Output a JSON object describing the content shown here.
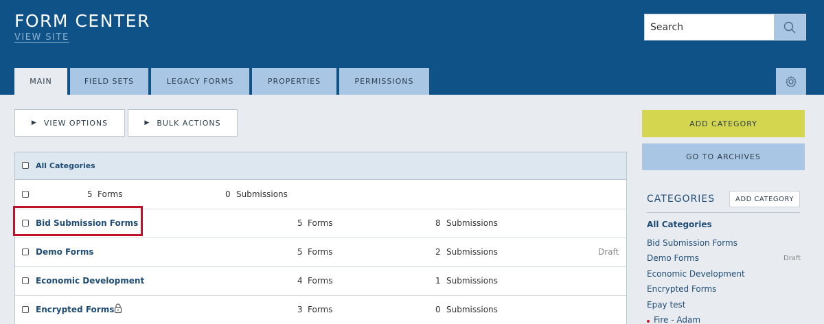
{
  "header": {
    "title": "FORM CENTER",
    "view_site": "VIEW SITE",
    "search_placeholder": "Search"
  },
  "tabs": [
    {
      "label": "MAIN",
      "active": true
    },
    {
      "label": "FIELD SETS"
    },
    {
      "label": "LEGACY FORMS"
    },
    {
      "label": "PROPERTIES"
    },
    {
      "label": "PERMISSIONS"
    }
  ],
  "toolbar": {
    "view_options": "VIEW OPTIONS",
    "bulk_actions": "BULK ACTIONS"
  },
  "table": {
    "header_label": "All Categories",
    "rows": [
      {
        "name": "",
        "forms": "5",
        "forms_label": "Forms",
        "submissions": "0",
        "submissions_label": "Submissions",
        "status": ""
      },
      {
        "name": "Bid Submission Forms",
        "forms": "5",
        "forms_label": "Forms",
        "submissions": "8",
        "submissions_label": "Submissions",
        "status": ""
      },
      {
        "name": "Demo Forms",
        "forms": "5",
        "forms_label": "Forms",
        "submissions": "2",
        "submissions_label": "Submissions",
        "status": "Draft"
      },
      {
        "name": "Economic Development",
        "forms": "4",
        "forms_label": "Forms",
        "submissions": "1",
        "submissions_label": "Submissions",
        "status": ""
      },
      {
        "name": "Encrypted Forms",
        "forms": "3",
        "forms_label": "Forms",
        "submissions": "0",
        "submissions_label": "Submissions",
        "status": "",
        "icon": "lock-icon"
      }
    ]
  },
  "sidebar": {
    "add_category": "ADD CATEGORY",
    "go_to_archives": "GO TO ARCHIVES",
    "categories_heading": "CATEGORIES",
    "categories_add": "ADD CATEGORY",
    "items": [
      {
        "label": "All Categories",
        "status": ""
      },
      {
        "label": "Bid Submission Forms",
        "status": ""
      },
      {
        "label": "Demo Forms",
        "status": "Draft"
      },
      {
        "label": "Economic Development",
        "status": ""
      },
      {
        "label": "Encrypted Forms",
        "status": ""
      },
      {
        "label": "Epay test",
        "status": ""
      },
      {
        "label": "Fire - Adam",
        "status": ""
      }
    ]
  },
  "colors": {
    "header_bg": "#0e5288",
    "tab_bg": "#a9c6e4",
    "add_category_bg": "#d4d650",
    "highlight": "#c0112b"
  }
}
